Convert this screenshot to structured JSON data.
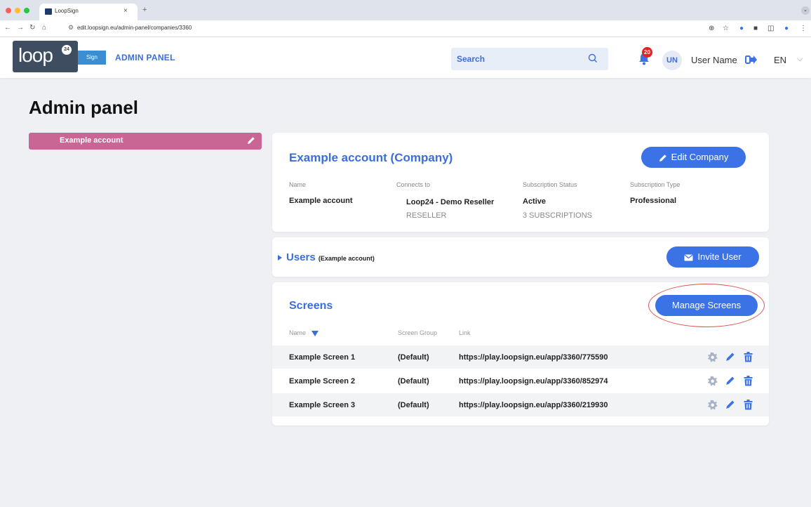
{
  "browser": {
    "tab_title": "LoopSign",
    "tab_close": "×",
    "new_tab": "+",
    "url": "edit.loopsign.eu/admin-panel/companies/3360"
  },
  "header": {
    "logo_text": "loop",
    "logo_badge": "24",
    "sign_badge": "Sign",
    "title": "ADMIN PANEL",
    "search_placeholder": "Search",
    "notification_count": "20",
    "avatar_initials": "UN",
    "user_name": "User Name",
    "language": "EN"
  },
  "page": {
    "title": "Admin panel"
  },
  "sidebar": {
    "items": [
      {
        "label": "Example account"
      }
    ]
  },
  "company": {
    "title": "Example account (Company)",
    "edit_button": "Edit Company",
    "fields": {
      "name_label": "Name",
      "name_value": "Example account",
      "connects_label": "Connects to",
      "connects_value": "Loop24 - Demo Reseller",
      "connects_sub": "RESELLER",
      "status_label": "Subscription Status",
      "status_value": "Active",
      "status_sub": "3 SUBSCRIPTIONS",
      "type_label": "Subscription Type",
      "type_value": "Professional"
    }
  },
  "users": {
    "title": "Users",
    "subtitle": "(Example account)",
    "invite_button": "Invite User"
  },
  "screens": {
    "title": "Screens",
    "manage_button": "Manage Screens",
    "columns": [
      "Name",
      "Screen Group",
      "Link"
    ],
    "rows": [
      {
        "name": "Example Screen 1",
        "group": "(Default)",
        "link": "https://play.loopsign.eu/app/3360/775590"
      },
      {
        "name": "Example Screen 2",
        "group": "(Default)",
        "link": "https://play.loopsign.eu/app/3360/852974"
      },
      {
        "name": "Example Screen 3",
        "group": "(Default)",
        "link": "https://play.loopsign.eu/app/3360/219930"
      }
    ]
  },
  "colors": {
    "primary": "#3b73e6",
    "accent_pink": "#c96694",
    "logo_bg": "#3e4d60",
    "annotation": "#d9534f"
  }
}
